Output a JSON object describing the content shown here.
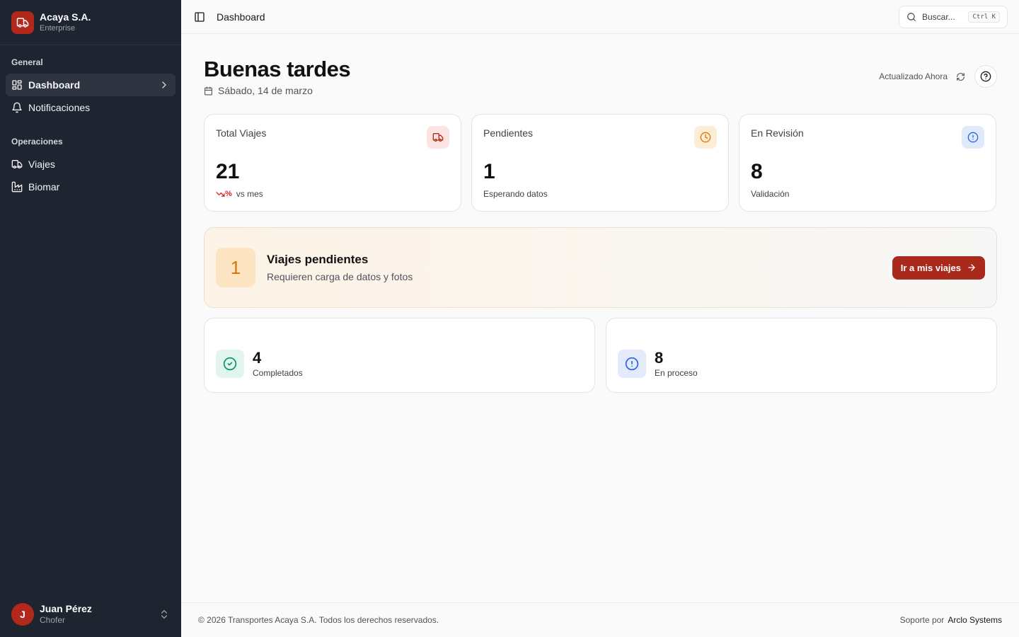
{
  "brand": {
    "name": "Acaya S.A.",
    "plan": "Enterprise"
  },
  "sidebar": {
    "groups": [
      {
        "label": "General",
        "items": [
          {
            "label": "Dashboard",
            "icon": "grid-icon",
            "active": true
          },
          {
            "label": "Notificaciones",
            "icon": "bell-icon"
          }
        ]
      },
      {
        "label": "Operaciones",
        "items": [
          {
            "label": "Viajes",
            "icon": "truck-icon"
          },
          {
            "label": "Biomar",
            "icon": "factory-icon"
          }
        ]
      }
    ]
  },
  "user": {
    "initial": "J",
    "name": "Juan Pérez",
    "role": "Chofer"
  },
  "header": {
    "breadcrumb": "Dashboard",
    "search_label": "Buscar...",
    "shortcut": "Ctrl K"
  },
  "main": {
    "greeting": "Buenas tardes",
    "date": "Sábado, 14 de marzo",
    "updated": "Actualizado Ahora"
  },
  "stats": [
    {
      "title": "Total Viajes",
      "value": "21",
      "trend": "%",
      "sub": "vs mes",
      "icon": "truck-icon",
      "color": "#b2291c",
      "bg": "#fbe4e1"
    },
    {
      "title": "Pendientes",
      "value": "1",
      "sub": "Esperando datos",
      "icon": "clock-icon",
      "color": "#d97706",
      "bg": "#fdecd6"
    },
    {
      "title": "En Revisión",
      "value": "8",
      "sub": "Validación",
      "icon": "alert-circle-icon",
      "color": "#2563eb",
      "bg": "#e0eafb"
    }
  ],
  "pending": {
    "count": "1",
    "title": "Viajes pendientes",
    "subtitle": "Requieren carga de datos y fotos",
    "cta": "Ir a mis viajes"
  },
  "summary": [
    {
      "value": "4",
      "label": "Completados",
      "icon": "check-circle-icon",
      "color": "#059669",
      "bg": "#e2f5ec"
    },
    {
      "value": "8",
      "label": "En proceso",
      "icon": "alert-circle-icon",
      "color": "#2563eb",
      "bg": "#e3ebfb"
    }
  ],
  "footer": {
    "copyright": "© 2026 Transportes Acaya S.A. Todos los derechos reservados.",
    "support_label": "Soporte por",
    "support_name": "Arclo Systems"
  }
}
